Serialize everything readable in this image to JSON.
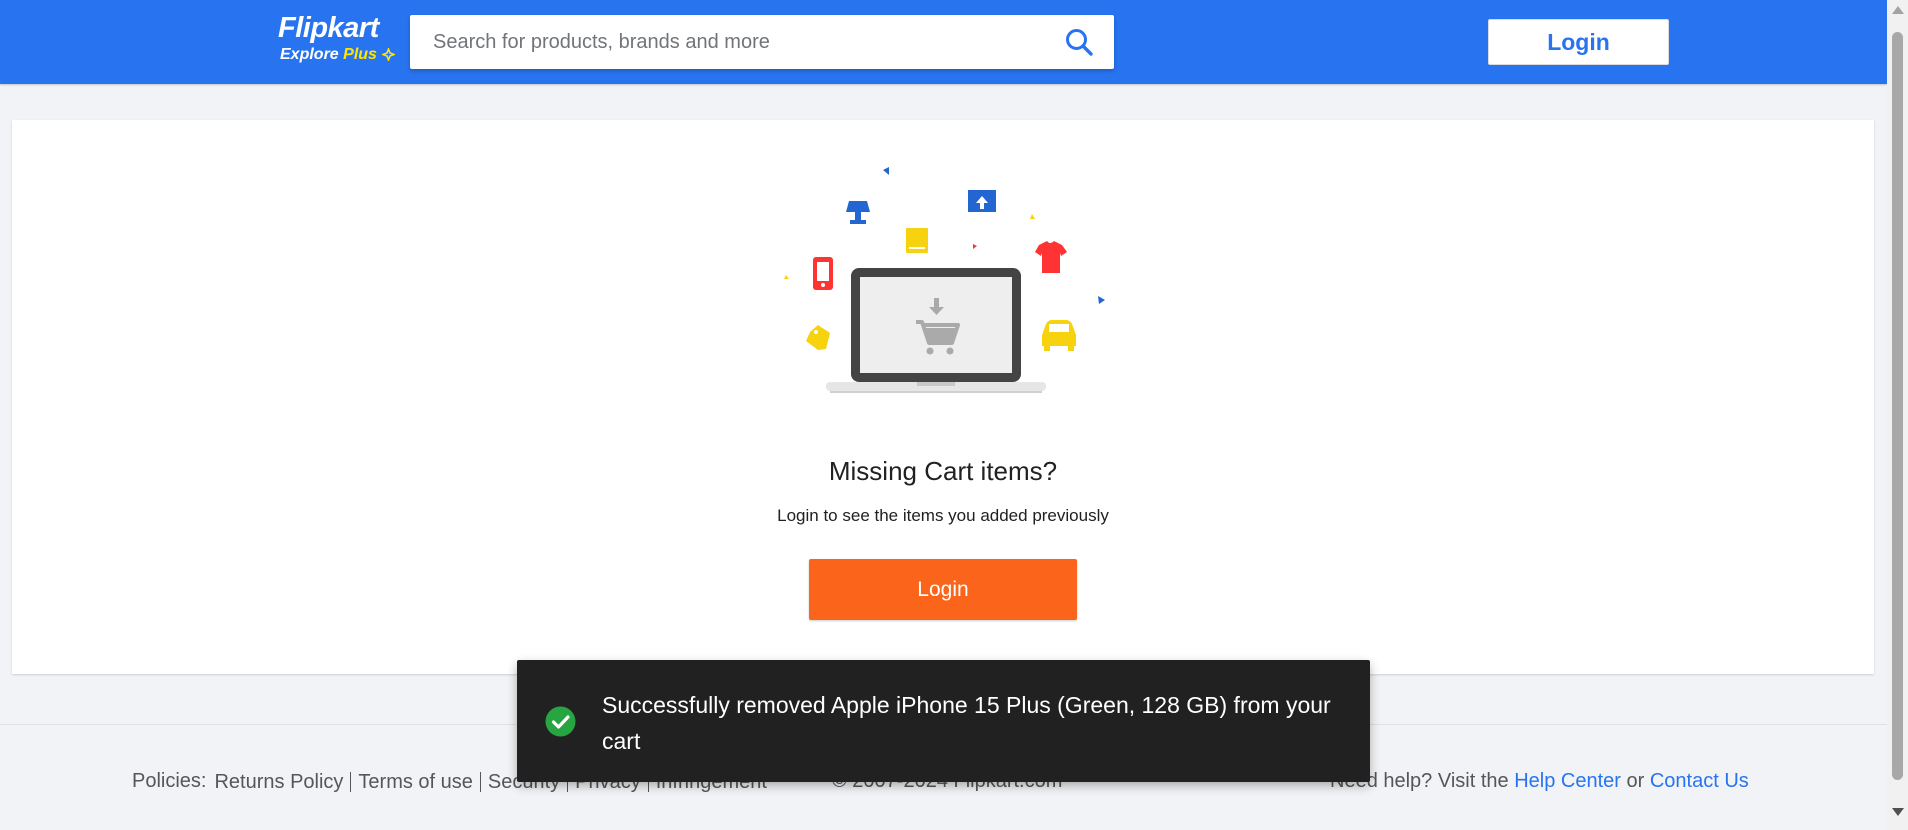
{
  "header": {
    "logo_main": "Flipkart",
    "logo_explore": "Explore",
    "logo_plus": "Plus",
    "search_placeholder": "Search for products, brands and more",
    "login_label": "Login",
    "brand_color": "#2874f0",
    "plus_color": "#ffe500"
  },
  "cart": {
    "title": "Missing Cart items?",
    "subtitle": "Login to see the items you added previously",
    "login_label": "Login",
    "login_color": "#fb641b",
    "illustration_icons": [
      "laptop-icon",
      "cart-icon",
      "lamp-icon",
      "book-icon",
      "monitor-icon",
      "shirt-icon",
      "phone-icon",
      "tag-icon",
      "car-icon"
    ]
  },
  "footer": {
    "policies_label": "Policies:",
    "policies": [
      "Returns Policy",
      "Terms of use",
      "Security",
      "Privacy",
      "Infringement"
    ],
    "copyright": "© 2007-2024 Flipkart.com",
    "help_prefix": "Need help? Visit the",
    "help_center": "Help Center",
    "or": "or",
    "contact": "Contact Us"
  },
  "toast": {
    "message": "Successfully removed Apple iPhone 15 Plus (Green, 128 GB) from your cart",
    "icon": "check-circle-icon",
    "success_color": "#26a541"
  }
}
